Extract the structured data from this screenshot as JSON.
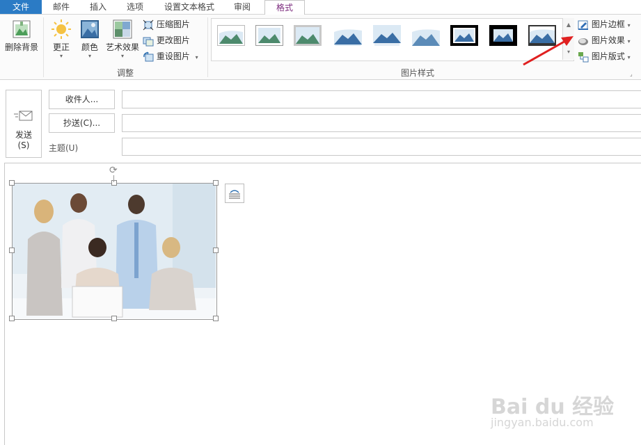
{
  "tabs": [
    {
      "label": "文件"
    },
    {
      "label": "邮件"
    },
    {
      "label": "插入"
    },
    {
      "label": "选项"
    },
    {
      "label": "设置文本格式"
    },
    {
      "label": "审阅"
    },
    {
      "label": "格式"
    }
  ],
  "ribbon": {
    "remove_background": "删除背景",
    "adjust": {
      "group_label": "调整",
      "corrections": "更正",
      "color": "颜色",
      "artistic_effects": "艺术效果",
      "compress": "压缩图片",
      "change": "更改图片",
      "reset": "重设图片"
    },
    "styles": {
      "group_label": "图片样式",
      "border": "图片边框",
      "effects": "图片效果",
      "layout": "图片版式"
    }
  },
  "compose": {
    "send_label": "发送",
    "send_key": "(S)",
    "to_button": "收件人...",
    "cc_button": "抄送(C)...",
    "subject_label": "主题(U)",
    "to_value": "",
    "cc_value": "",
    "subject_value": ""
  },
  "watermark": {
    "brand": "Bai du 经验",
    "url": "jingyan.baidu.com"
  },
  "colors": {
    "file_tab": "#2b7bc5",
    "active_tab_text": "#7b2a7d",
    "arrow": "#e02020"
  }
}
